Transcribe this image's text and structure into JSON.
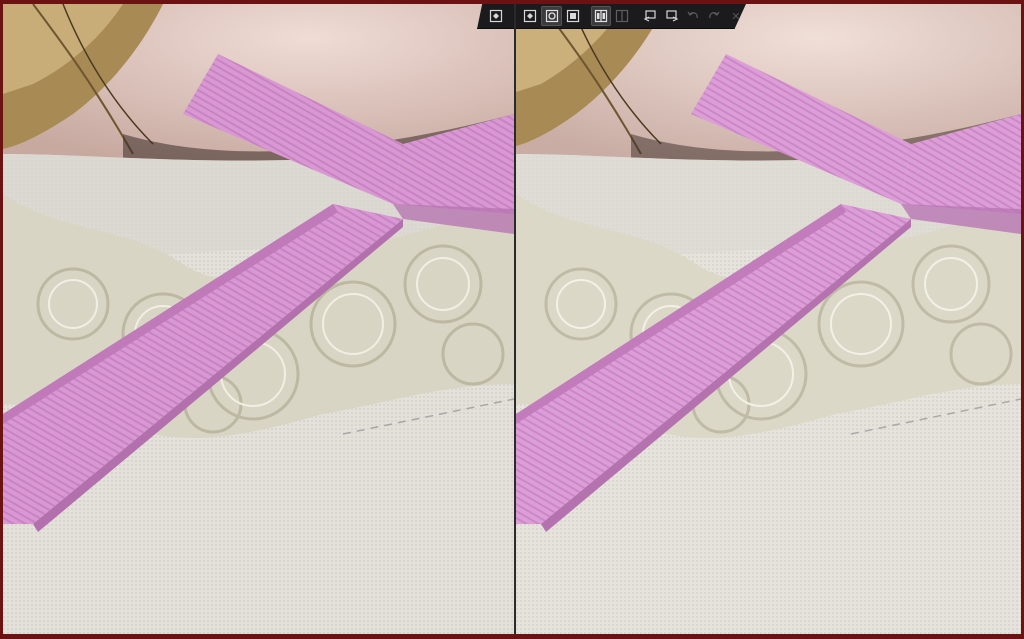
{
  "window": {
    "frame_color": "#6b1212",
    "panels": [
      "left-preview",
      "right-preview"
    ]
  },
  "toolbar_left": {
    "buttons": [
      {
        "icon": "fit-view-icon",
        "state": "normal"
      }
    ]
  },
  "toolbar_right": {
    "buttons": [
      {
        "icon": "fit-view-icon",
        "state": "normal"
      },
      {
        "icon": "zoom-region-icon",
        "state": "active"
      },
      {
        "icon": "zoom-actual-icon",
        "state": "normal"
      },
      {
        "icon": "split-view-icon",
        "state": "active"
      },
      {
        "icon": "single-view-icon",
        "state": "disabled"
      },
      {
        "icon": "swap-left-icon",
        "state": "normal"
      },
      {
        "icon": "swap-right-icon",
        "state": "normal"
      },
      {
        "icon": "undo-icon",
        "state": "disabled"
      },
      {
        "icon": "redo-icon",
        "state": "disabled"
      },
      {
        "icon": "close-icon",
        "state": "disabled",
        "glyph": "✕"
      }
    ]
  },
  "colors": {
    "ribbon": "#d89ad4",
    "ribbon_shadow": "#b070b0",
    "fabric": "#e4e2dc",
    "lace": "#d8d4c4",
    "hair": "#b59a66",
    "skin": "#e9d3cd"
  }
}
